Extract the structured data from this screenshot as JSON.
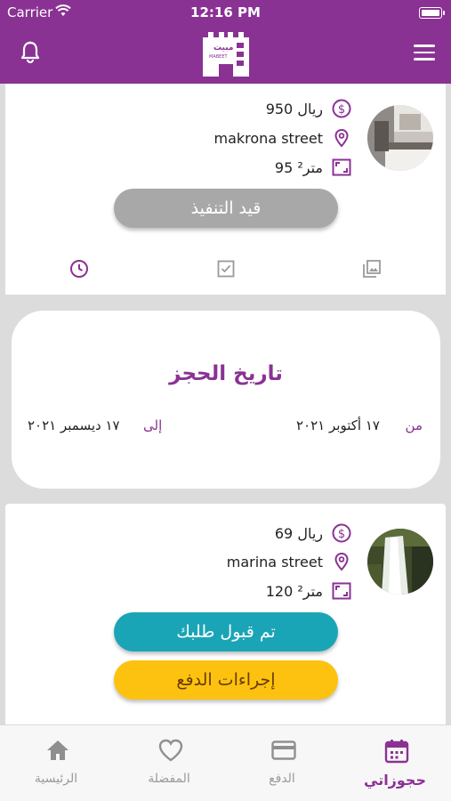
{
  "status_bar": {
    "carrier": "Carrier",
    "time": "12:16 PM",
    "wifi_icon": "wifi-icon",
    "battery_icon": "battery-icon"
  },
  "nav_bar": {
    "logo_text_ar": "مبيت",
    "logo_text_en": "MABEET",
    "left_icon": "bell-icon",
    "right_icon": "hamburger-menu-icon",
    "color": "#8a3293"
  },
  "bookings": [
    {
      "price": "950 ريال",
      "location": "makrona street",
      "area": "95 متر²",
      "status_label": "قيد التنفيذ",
      "status_color": "#a8a8a8"
    },
    {
      "price": "69 ريال",
      "location": "marina street",
      "area": "120 متر²",
      "status_label": "تم قبول طلبك",
      "status_color": "#1aa5b6",
      "payment_label": "إجراءات الدفع",
      "payment_color": "#fcc20f"
    }
  ],
  "card_tabs": [
    "clock-icon",
    "checkbox-icon",
    "gallery-icon"
  ],
  "booking_date": {
    "title": "تاريخ الحجز",
    "from_label": "من",
    "from_value": "١٧ أكتوبر ٢٠٢١",
    "to_label": "إلى",
    "to_value": "١٧ ديسمبر ٢٠٢١"
  },
  "tabbar": {
    "items": [
      {
        "label": "الرئيسية",
        "icon": "home-icon"
      },
      {
        "label": "المفضلة",
        "icon": "heart-icon"
      },
      {
        "label": "الدفع",
        "icon": "credit-card-icon"
      },
      {
        "label": "حجوزاتي",
        "icon": "calendar-icon",
        "active": true
      }
    ],
    "active_color": "#8a3293",
    "inactive_color": "#9a9a9a"
  }
}
